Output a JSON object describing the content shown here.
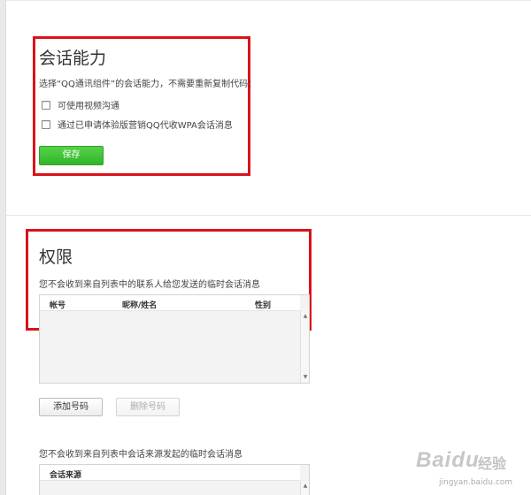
{
  "session_section": {
    "title": "会话能力",
    "description": "选择“QQ通讯组件”的会话能力，不需要重新复制代码：",
    "options": [
      {
        "label": "可使用视频沟通",
        "checked": false
      },
      {
        "label": "通过已申请体验版营销QQ代收WPA会话消息",
        "checked": false
      }
    ],
    "save_label": "保存"
  },
  "permission_section": {
    "title": "权限",
    "contacts_description": "您不会收到来自列表中的联系人给您发送的临时会话消息",
    "contacts_table": {
      "columns": [
        "帐号",
        "昵称/姓名",
        "性别"
      ]
    },
    "add_label": "添加号码",
    "delete_label": "删除号码",
    "source_description": "您不会收到来自列表中会话来源发起的临时会话消息",
    "source_table": {
      "columns": [
        "会话来源"
      ]
    }
  },
  "watermark": {
    "logo": "Baidu",
    "text": "经验",
    "url": "jingyan.baidu.com"
  },
  "colors": {
    "highlight": "#d9131a",
    "save_button": "#3cbf33"
  }
}
